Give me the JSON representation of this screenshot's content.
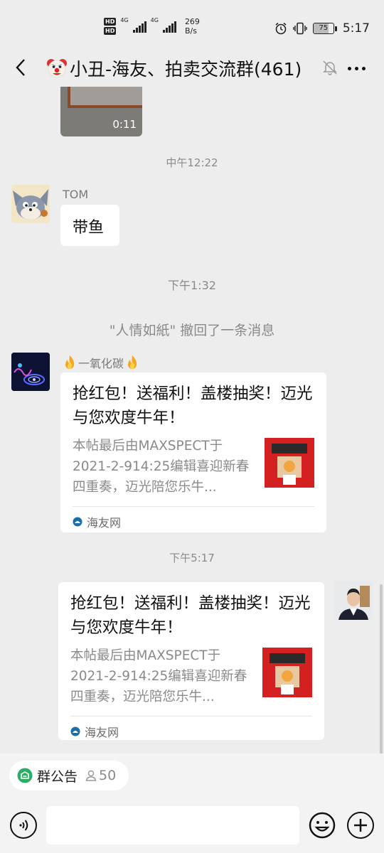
{
  "status_bar": {
    "hd1": "HD",
    "hd2": "HD",
    "net1": "4G",
    "net2": "4G",
    "speed_value": "269",
    "speed_unit": "B/s",
    "battery": "75",
    "battery_level_percent": 75,
    "time": "5:17",
    "icons": [
      "alarm-icon",
      "vibrate-icon",
      "battery-icon"
    ]
  },
  "header": {
    "title": "小丑-海友、拍卖交流群(461)",
    "icons": [
      "back-icon",
      "clown-emoji-icon",
      "mute-icon",
      "more-icon"
    ]
  },
  "chat": {
    "video_duration": "0:11",
    "time_1": "中午12:22",
    "msg_tom": {
      "sender": "TOM",
      "text": "带鱼"
    },
    "time_2": "下午1:32",
    "recall_notice": "\"人情如紙\" 撤回了一条消息",
    "msg_co": {
      "sender": "一氧化碳",
      "card": {
        "title": "抢红包！送福利！盖楼抽奖！迈光与您欢度牛年！",
        "desc": "本帖最后由MAXSPECT于2021-2-914:25编辑喜迎新春四重奏，迈光陪您乐牛...",
        "source": "海友网"
      }
    },
    "time_3": "下午5:17",
    "msg_self": {
      "card": {
        "title": "抢红包！送福利！盖楼抽奖！迈光与您欢度牛年！",
        "desc": "本帖最后由MAXSPECT于2021-2-914:25编辑喜迎新春四重奏，迈光陪您乐牛...",
        "source": "海友网"
      }
    }
  },
  "bottom": {
    "notice_label": "群公告",
    "notice_count": "50",
    "input_placeholder": "",
    "icons": [
      "voice-icon",
      "emoji-icon",
      "plus-icon"
    ]
  }
}
